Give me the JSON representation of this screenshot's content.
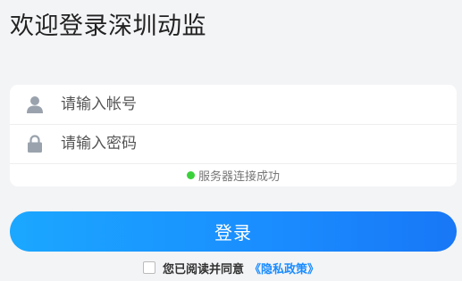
{
  "title": "欢迎登录深圳动监",
  "form": {
    "username_placeholder": "请输入帐号",
    "password_placeholder": "请输入密码",
    "username_icon": "user-icon",
    "password_icon": "lock-icon"
  },
  "status": {
    "text": "服务器连接成功",
    "dot_color": "#3bd13b"
  },
  "login_button": {
    "label": "登录"
  },
  "agreement": {
    "text": "您已阅读并同意",
    "link_text": "《隐私政策》",
    "checked": false
  },
  "colors": {
    "accent": "#1a8cff"
  }
}
